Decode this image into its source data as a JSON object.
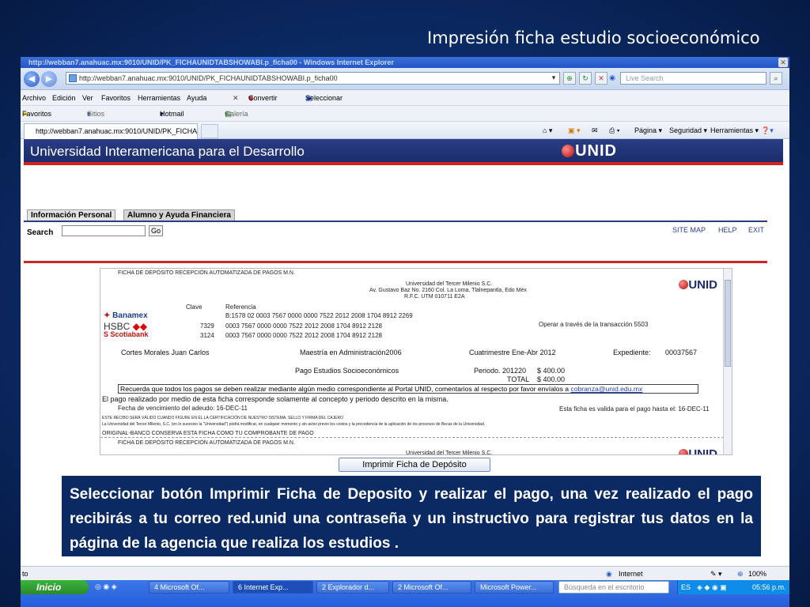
{
  "slide": {
    "title": "Impresión ficha estudio socioeconómico"
  },
  "browser": {
    "window_title": "http://webban7.anahuac.mx:9010/UNID/PK_FICHAUNIDTABSHOWABI.p_ficha00 - Windows Internet Explorer",
    "address": "http://webban7.anahuac.mx:9010/UNID/PK_FICHAUNIDTABSHOWABI.p_ficha00",
    "live_search_placeholder": "Live Search",
    "menu": [
      "Archivo",
      "Edición",
      "Ver",
      "Favoritos",
      "Herramientas",
      "Ayuda"
    ],
    "convert_label": "Convertir",
    "select_label": "Seleccionar",
    "favorites_label": "Favoritos",
    "fav_links": [
      "Sitios sugeridos",
      "Hotmail gratuito",
      "Galería de Web Slice"
    ],
    "tab_label": "http://webban7.anahuac.mx:9010/UNID/PK_FICHAU...",
    "cmd_pagina": "Página",
    "cmd_seguridad": "Seguridad",
    "cmd_herramientas": "Herramientas",
    "status_left": "to",
    "status_zone": "Internet",
    "zoom": "100%"
  },
  "site": {
    "banner_title": "Universidad Interamericana para el Desarrollo",
    "logo_text": "UNID",
    "tabs": [
      "Información Personal",
      "Alumno y Ayuda Financiera"
    ],
    "search_label": "Search",
    "go_label": "Go",
    "links": [
      "SITE MAP",
      "HELP",
      "EXIT"
    ]
  },
  "ficha": {
    "header": "FICHA DE DEPÓSITO RECEPCIÓN AUTOMATIZADA DE PAGOS M.N.",
    "school_lines": [
      "Universidad del Tercer Milenio S.C.",
      "Av. Gustavo Baz No. 2160 Col. La Loma, Tlalnepantla, Edo Méx",
      "R.F.C. UTM 010711 E2A"
    ],
    "col_clave": "Clave",
    "col_referencia": "Referencia",
    "banks": [
      {
        "name": "Banamex",
        "clave": "",
        "ref": "B:1578 02  0003 7567 0000 0000 7522 2012 2008 1704 8912 2269"
      },
      {
        "name": "HSBC",
        "clave": "7329",
        "ref": "0003 7567 0000 0000 7522 2012 2008 1704 8912 2128"
      },
      {
        "name": "Scotiabank",
        "clave": "3124",
        "ref": "0003 7567 0000 0000 7522 2012 2008 1704 8912 2128"
      }
    ],
    "transaction_note": "Operar a través de la transacción 5503",
    "student": "Cortes Morales Juan Carlos",
    "program": "Maestría en Administración2006",
    "term": "Cuatrimestre Ene-Abr 2012",
    "exp_label": "Expediente:",
    "exp_value": "00037567",
    "concept": "Pago Estudios Socioeconómicos",
    "period_label": "Periodo. 201220",
    "period_amount": "$   400.00",
    "total_label": "TOTAL",
    "total_amount": "$   400.00",
    "notice_text": "Recuerda que todos los pagos se deben realizar mediante algún medio correspondiente al Portal UNID, comentarios al respecto por favor envíalos a ",
    "notice_email": "cobranza@unid.edu.mx",
    "valid_line": "El pago realizado por medio de esta ficha corresponde solamente al concepto y periodo descrito en la misma.",
    "due_line": "Fecha de vencimiento del adeudo:  16-DEC-11",
    "valid_until": "Esta ficha es valida para el pago hasta el:  16-DEC-11",
    "legal_1": "ESTE RECIBO SERÁ VÁLIDO CUANDO FIGURE EN ÉL LA CERTIFICACIÓN DE NUESTRO SISTEMA, SELLO Y FIRMA DEL CAJERO",
    "legal_2": "La Universidad del Tercer Milenio, S.C. (en lo sucesivo la \"Universidad\") podrá modificar, en cualquier momento y sin aviso previo los costos y la procedencia de la aplicación de los procesos de Becas de la Universidad.",
    "copy_line": "ORIGINAL-BANCO CONSERVA ESTA FICHA COMO TU COMPROBANTE DE PAGO",
    "print_button": "Imprimir Ficha de Depósito"
  },
  "callout": {
    "text": "Seleccionar botón Imprimir Ficha de Deposito y realizar el pago, una vez realizado el pago recibirás a tu correo red.unid  una  contraseña y un instructivo para registrar tus datos en la página de la agencia que realiza los estudios ."
  },
  "taskbar": {
    "start": "Inicio",
    "items": [
      "4 Microsoft Of...",
      "6 Internet Exp...",
      "2 Explorador d...",
      "2 Microsoft Of...",
      "Microsoft Power...",
      "Búsqueda en el escritorio"
    ],
    "lang": "ES",
    "clock": "05:56 p.m."
  }
}
